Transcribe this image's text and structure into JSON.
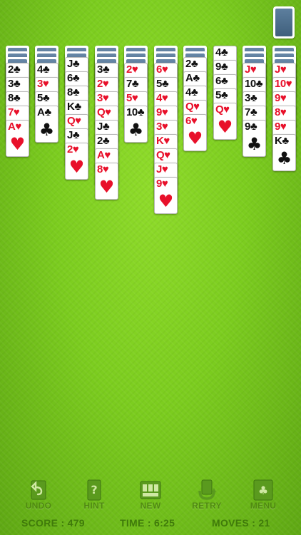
{
  "colors": {
    "felt": "#7ccd1f",
    "red_suit": "#e8102a",
    "black_suit": "#111111",
    "card_back": "#4f7192",
    "toolbar_text": "#4f8a10"
  },
  "stock": {
    "icon": "card-back"
  },
  "tableau": [
    {
      "down": 3,
      "up": [
        {
          "r": "2",
          "s": "♣",
          "c": "black"
        },
        {
          "r": "3",
          "s": "♣",
          "c": "black"
        },
        {
          "r": "8",
          "s": "♣",
          "c": "black"
        },
        {
          "r": "7",
          "s": "♥",
          "c": "red"
        },
        {
          "r": "A",
          "s": "♥",
          "c": "red"
        }
      ]
    },
    {
      "down": 3,
      "up": [
        {
          "r": "4",
          "s": "♣",
          "c": "black"
        },
        {
          "r": "3",
          "s": "♥",
          "c": "red"
        },
        {
          "r": "5",
          "s": "♣",
          "c": "black"
        },
        {
          "r": "A",
          "s": "♣",
          "c": "black"
        }
      ]
    },
    {
      "down": 2,
      "up": [
        {
          "r": "J",
          "s": "♣",
          "c": "black"
        },
        {
          "r": "6",
          "s": "♣",
          "c": "black"
        },
        {
          "r": "8",
          "s": "♣",
          "c": "black"
        },
        {
          "r": "K",
          "s": "♣",
          "c": "black"
        },
        {
          "r": "Q",
          "s": "♥",
          "c": "red"
        },
        {
          "r": "J",
          "s": "♣",
          "c": "black"
        },
        {
          "r": "2",
          "s": "♥",
          "c": "red"
        }
      ]
    },
    {
      "down": 3,
      "up": [
        {
          "r": "3",
          "s": "♣",
          "c": "black"
        },
        {
          "r": "2",
          "s": "♥",
          "c": "red"
        },
        {
          "r": "3",
          "s": "♥",
          "c": "red"
        },
        {
          "r": "Q",
          "s": "♥",
          "c": "red"
        },
        {
          "r": "J",
          "s": "♣",
          "c": "black"
        },
        {
          "r": "2",
          "s": "♣",
          "c": "black"
        },
        {
          "r": "A",
          "s": "♥",
          "c": "red"
        },
        {
          "r": "8",
          "s": "♥",
          "c": "red"
        }
      ]
    },
    {
      "down": 3,
      "up": [
        {
          "r": "2",
          "s": "♥",
          "c": "red"
        },
        {
          "r": "7",
          "s": "♣",
          "c": "black"
        },
        {
          "r": "5",
          "s": "♥",
          "c": "red"
        },
        {
          "r": "10",
          "s": "♣",
          "c": "black"
        }
      ]
    },
    {
      "down": 3,
      "up": [
        {
          "r": "6",
          "s": "♥",
          "c": "red"
        },
        {
          "r": "5",
          "s": "♣",
          "c": "black"
        },
        {
          "r": "4",
          "s": "♥",
          "c": "red"
        },
        {
          "r": "9",
          "s": "♥",
          "c": "red"
        },
        {
          "r": "3",
          "s": "♥",
          "c": "red"
        },
        {
          "r": "K",
          "s": "♥",
          "c": "red"
        },
        {
          "r": "Q",
          "s": "♥",
          "c": "red"
        },
        {
          "r": "J",
          "s": "♥",
          "c": "red"
        },
        {
          "r": "9",
          "s": "♥",
          "c": "red"
        }
      ]
    },
    {
      "down": 2,
      "up": [
        {
          "r": "2",
          "s": "♣",
          "c": "black"
        },
        {
          "r": "A",
          "s": "♣",
          "c": "black"
        },
        {
          "r": "4",
          "s": "♣",
          "c": "black"
        },
        {
          "r": "Q",
          "s": "♥",
          "c": "red"
        },
        {
          "r": "6",
          "s": "♥",
          "c": "red"
        }
      ]
    },
    {
      "down": 0,
      "up": [
        {
          "r": "4",
          "s": "♣",
          "c": "black"
        },
        {
          "r": "9",
          "s": "♣",
          "c": "black"
        },
        {
          "r": "6",
          "s": "♣",
          "c": "black"
        },
        {
          "r": "5",
          "s": "♣",
          "c": "black"
        },
        {
          "r": "Q",
          "s": "♥",
          "c": "red"
        }
      ]
    },
    {
      "down": 3,
      "up": [
        {
          "r": "J",
          "s": "♥",
          "c": "red"
        },
        {
          "r": "10",
          "s": "♣",
          "c": "black"
        },
        {
          "r": "3",
          "s": "♣",
          "c": "black"
        },
        {
          "r": "7",
          "s": "♣",
          "c": "black"
        },
        {
          "r": "9",
          "s": "♣",
          "c": "black"
        }
      ]
    },
    {
      "down": 3,
      "up": [
        {
          "r": "J",
          "s": "♥",
          "c": "red"
        },
        {
          "r": "10",
          "s": "♥",
          "c": "red"
        },
        {
          "r": "9",
          "s": "♥",
          "c": "red"
        },
        {
          "r": "8",
          "s": "♥",
          "c": "red"
        },
        {
          "r": "9",
          "s": "♥",
          "c": "red"
        },
        {
          "r": "K",
          "s": "♣",
          "c": "black"
        }
      ]
    }
  ],
  "toolbar": {
    "undo": {
      "label": "UNDO",
      "icon": "undo-arrow"
    },
    "hint": {
      "label": "HINT",
      "icon": "hint-card-question"
    },
    "new": {
      "label": "NEW",
      "icon": "new-deal-cards"
    },
    "retry": {
      "label": "RETRY",
      "icon": "retry-circular-arrow"
    },
    "menu": {
      "label": "MENU",
      "icon": "menu-card-clubs"
    }
  },
  "status": {
    "score": "SCORE : 479",
    "time": "TIME : 6:25",
    "moves": "MOVES : 21"
  }
}
